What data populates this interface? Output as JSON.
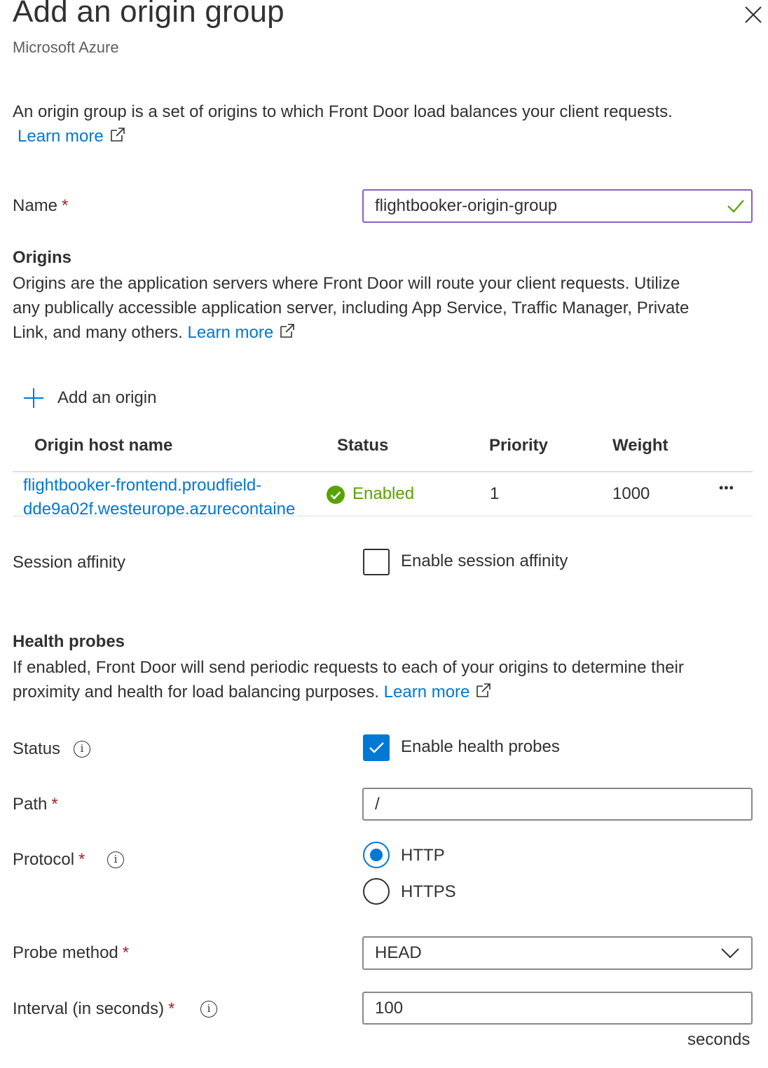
{
  "header": {
    "title": "Add an origin group",
    "subtitle": "Microsoft Azure",
    "close_icon": "close-icon"
  },
  "intro": {
    "text": "An origin group is a set of origins to which Front Door load balances your client requests.",
    "learn_more": "Learn more"
  },
  "name_field": {
    "label": "Name",
    "required": "*",
    "value": "flightbooker-origin-group",
    "valid_icon": "checkmark-icon"
  },
  "origins": {
    "heading": "Origins",
    "desc_line1": "Origins are the application servers where Front Door will route your client requests. Utilize",
    "desc_line2": "any publically accessible application server, including App Service, Traffic Manager, Private",
    "desc_line3": "Link, and many others.",
    "learn_more": "Learn more",
    "add_label": "Add an origin",
    "columns": [
      "Origin host name",
      "Status",
      "Priority",
      "Weight"
    ],
    "rows": [
      {
        "host_line1": "flightbooker-frontend.proudfield-",
        "host_line2": "dde9a02f.westeurope.azurecontaine",
        "status": "Enabled",
        "priority": "1",
        "weight": "1000",
        "more": "•••"
      }
    ]
  },
  "session_affinity": {
    "label": "Session affinity",
    "checkbox_label": "Enable session affinity",
    "checked": false
  },
  "health_probes": {
    "heading": "Health probes",
    "desc_line1": "If enabled, Front Door will send periodic requests to each of your origins to determine their",
    "desc_line2": "proximity and health for load balancing purposes.",
    "learn_more": "Learn more",
    "status_label": "Status",
    "status_checkbox_label": "Enable health probes",
    "status_checked": true,
    "path_label": "Path",
    "path_value": "/",
    "protocol_label": "Protocol",
    "protocol_options": [
      "HTTP",
      "HTTPS"
    ],
    "protocol_selected": "HTTP",
    "probe_method_label": "Probe method",
    "probe_method_value": "HEAD",
    "interval_label": "Interval (in seconds)",
    "interval_value": "100",
    "interval_unit": "seconds",
    "required": "*"
  },
  "colors": {
    "accent": "#0078d4",
    "success": "#57a300",
    "required": "#a4262c",
    "focus_border": "#8661c5"
  }
}
